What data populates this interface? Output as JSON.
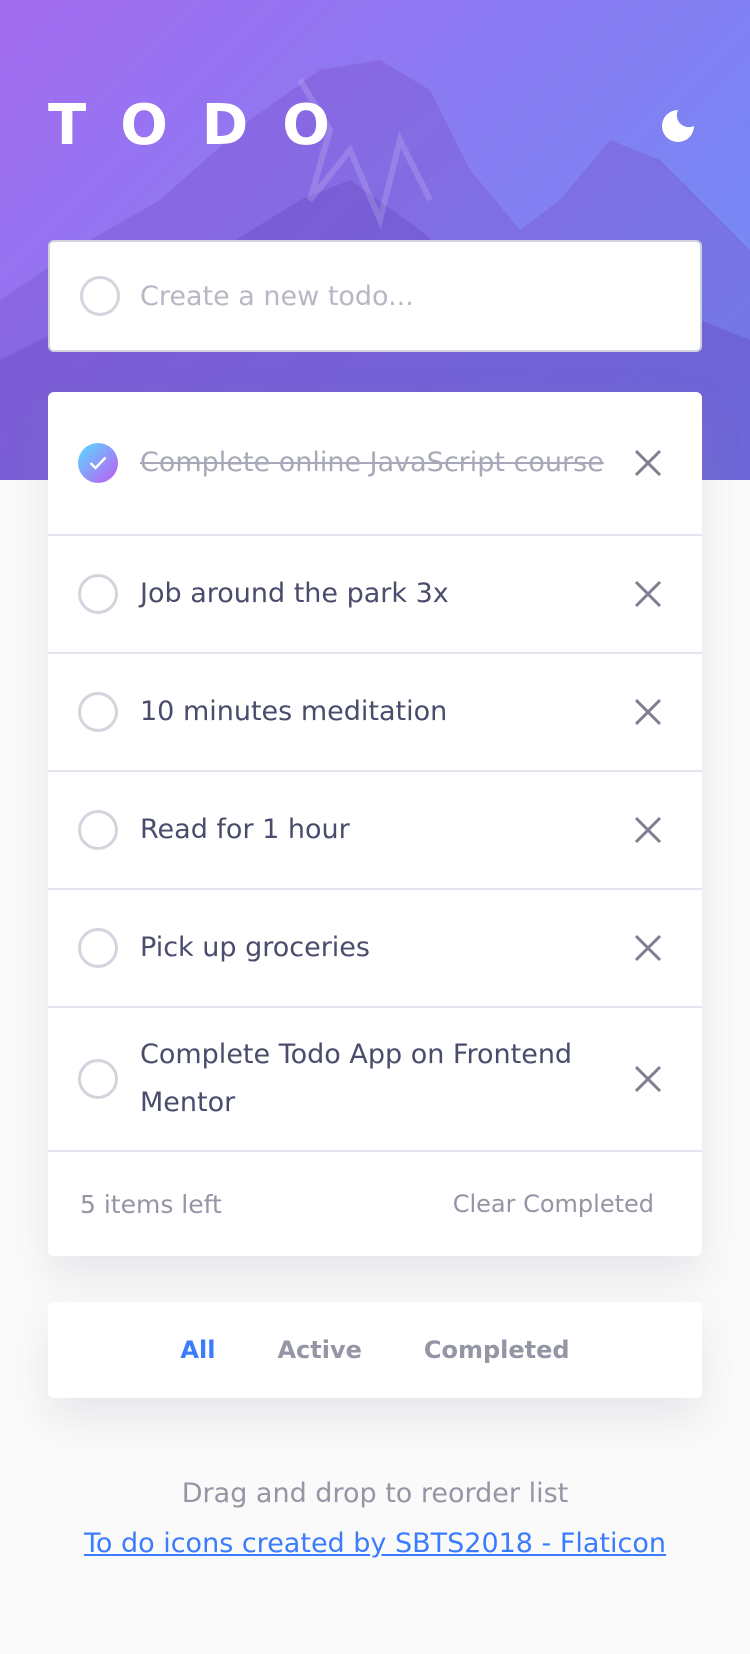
{
  "app": {
    "title": "TODO"
  },
  "colors": {
    "accent": "#3a7cfd",
    "gradient_start": "#57ddff",
    "gradient_end": "#c058f3",
    "text": "#494c6b",
    "muted": "#9495a5"
  },
  "header": {
    "theme_toggle_icon": "moon-icon"
  },
  "new_todo": {
    "placeholder": "Create a new todo...",
    "value": ""
  },
  "todos": [
    {
      "text": "Complete online JavaScript course",
      "completed": true
    },
    {
      "text": "Job around the park 3x",
      "completed": false
    },
    {
      "text": "10 minutes meditation",
      "completed": false
    },
    {
      "text": "Read for 1 hour",
      "completed": false
    },
    {
      "text": "Pick up groceries",
      "completed": false
    },
    {
      "text": "Complete Todo App on Frontend Mentor",
      "completed": false
    }
  ],
  "footer": {
    "items_left": "5 items left",
    "clear_label": "Clear Completed"
  },
  "filters": {
    "all": "All",
    "active": "Active",
    "completed": "Completed",
    "selected": "All"
  },
  "hint": "Drag and drop to reorder list",
  "credit": "To do icons created by SBTS2018 - Flaticon",
  "icons": {
    "check": "check-icon",
    "delete": "close-icon",
    "theme": "moon-icon"
  }
}
